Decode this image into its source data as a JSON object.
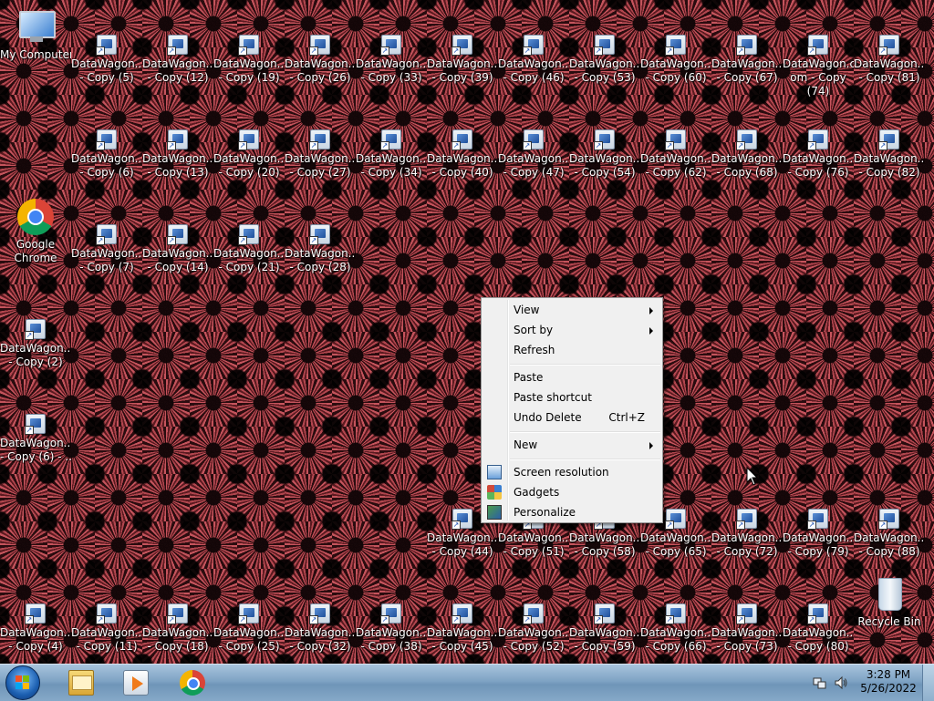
{
  "desktop": {
    "special_icons": {
      "my_computer": "My Computer",
      "google_chrome": [
        "Google",
        "Chrome"
      ],
      "recycle_bin": "Recycle Bin"
    },
    "shortcuts": [
      [
        "DataWagon....",
        "- Copy (5)"
      ],
      [
        "DataWagon...",
        "- Copy (12)"
      ],
      [
        "DataWagon...",
        "- Copy (19)"
      ],
      [
        "DataWagon...",
        "- Copy (26)"
      ],
      [
        "DataWagon...",
        "- Copy (33)"
      ],
      [
        "DataWagon...",
        "- Copy (39)"
      ],
      [
        "DataWagon...",
        "- Copy (46)"
      ],
      [
        "DataWagon...",
        "- Copy (53)"
      ],
      [
        "DataWagon...",
        "- Copy (60)"
      ],
      [
        "DataWagon...",
        "- Copy (67)"
      ],
      [
        "DataWagon.c",
        "om - Copy",
        "(74)"
      ],
      [
        "DataWagon...",
        "- Copy (81)"
      ],
      [
        "DataWagon....",
        "- Copy (6)"
      ],
      [
        "DataWagon...",
        "- Copy (13)"
      ],
      [
        "DataWagon...",
        "- Copy (20)"
      ],
      [
        "DataWagon...",
        "- Copy (27)"
      ],
      [
        "DataWagon...",
        "- Copy (34)"
      ],
      [
        "DataWagon...",
        "- Copy (40)"
      ],
      [
        "DataWagon...",
        "- Copy (47)"
      ],
      [
        "DataWagon...",
        "- Copy (54)"
      ],
      [
        "DataWagon...",
        "- Copy (62)"
      ],
      [
        "DataWagon...",
        "- Copy (68)"
      ],
      [
        "DataWagon...",
        "- Copy (76)"
      ],
      [
        "DataWagon...",
        "- Copy (82)"
      ],
      [
        "DataWagon....",
        "- Copy (7)"
      ],
      [
        "DataWagon...",
        "- Copy (14)"
      ],
      [
        "DataWagon...",
        "- Copy (21)"
      ],
      [
        "DataWagon...",
        "- Copy (28)"
      ],
      [
        "DataWagon....",
        "- Copy (2)"
      ],
      [
        "DataWagon....",
        "- Copy (6) - ..."
      ],
      [
        "DataWagon...",
        "- Copy (44)"
      ],
      [
        "DataWagon...",
        "- Copy (51)"
      ],
      [
        "DataWagon...",
        "- Copy (58)"
      ],
      [
        "DataWagon...",
        "- Copy (65)"
      ],
      [
        "DataWagon...",
        "- Copy (72)"
      ],
      [
        "DataWagon...",
        "- Copy (79)"
      ],
      [
        "DataWagon...",
        "- Copy (88)"
      ],
      [
        "DataWagon....",
        "- Copy (4)"
      ],
      [
        "DataWagon...",
        "- Copy (11)"
      ],
      [
        "DataWagon...",
        "- Copy (18)"
      ],
      [
        "DataWagon...",
        "- Copy (25)"
      ],
      [
        "DataWagon...",
        "- Copy (32)"
      ],
      [
        "DataWagon...",
        "- Copy (38)"
      ],
      [
        "DataWagon...",
        "- Copy (45)"
      ],
      [
        "DataWagon...",
        "- Copy (52)"
      ],
      [
        "DataWagon...",
        "- Copy (59)"
      ],
      [
        "DataWagon...",
        "- Copy (66)"
      ],
      [
        "DataWagon...",
        "- Copy (73)"
      ],
      [
        "DataWagon...",
        "- Copy (80)"
      ]
    ]
  },
  "context_menu": {
    "items": [
      {
        "label": "View",
        "submenu": true
      },
      {
        "label": "Sort by",
        "submenu": true
      },
      {
        "label": "Refresh"
      },
      {
        "label": "Paste"
      },
      {
        "label": "Paste shortcut"
      },
      {
        "label": "Undo Delete",
        "shortcut": "Ctrl+Z"
      },
      {
        "label": "New",
        "submenu": true
      },
      {
        "label": "Screen resolution",
        "icon": "screen-resolution-icon"
      },
      {
        "label": "Gadgets",
        "icon": "gadgets-icon"
      },
      {
        "label": "Personalize",
        "icon": "personalize-icon"
      }
    ]
  },
  "taskbar": {
    "pinned": [
      "windows-explorer-icon",
      "media-player-icon",
      "google-chrome-icon"
    ],
    "tray": [
      "network-icon",
      "volume-icon"
    ],
    "clock": {
      "time": "3:28 PM",
      "date": "5/26/2022"
    }
  },
  "colors": {
    "wallpaper_red": "#c5545c",
    "menu_bg": "#f0f0f0",
    "taskbar": "#7fa3c4"
  }
}
